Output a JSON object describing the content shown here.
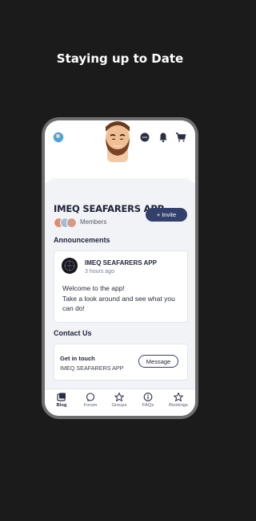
{
  "headline": "Staying up to Date",
  "header": {
    "avatar_icon": "user-avatar-icon",
    "icons": [
      "chat-icon",
      "bell-icon",
      "cart-icon"
    ]
  },
  "site": {
    "title": "IMEQ SEAFARERS APP",
    "members_label": "Members",
    "invite_label": "Invite"
  },
  "announcements": {
    "section_title": "Announcements",
    "post": {
      "author": "IMEQ SEAFARERS APP",
      "time": "3 hours ago",
      "body": "Welcome to the app!\nTake a look around and see what you can do!"
    }
  },
  "contact": {
    "section_title": "Contact Us",
    "heading": "Get in touch",
    "name": "IMEQ SEAFARERS APP",
    "button_label": "Message"
  },
  "bottom_nav": [
    {
      "label": "Blog",
      "icon": "blog-icon",
      "active": true
    },
    {
      "label": "Forum",
      "icon": "forum-icon",
      "active": false
    },
    {
      "label": "Groups",
      "icon": "star-icon",
      "active": false
    },
    {
      "label": "FAQs",
      "icon": "info-icon",
      "active": false
    },
    {
      "label": "Bookings",
      "icon": "star-icon",
      "active": false
    }
  ]
}
